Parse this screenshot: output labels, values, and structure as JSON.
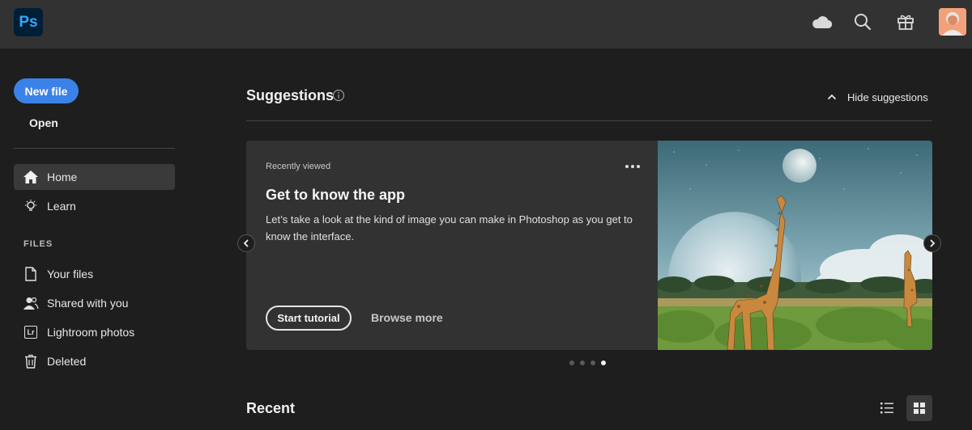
{
  "app": {
    "logo_text": "Ps"
  },
  "header": {
    "icons": [
      "cloud-icon",
      "search-icon",
      "gift-icon"
    ],
    "avatar": "avatar"
  },
  "sidebar": {
    "new_file_label": "New file",
    "open_label": "Open",
    "nav": [
      {
        "label": "Home",
        "icon": "home-icon",
        "active": true
      },
      {
        "label": "Learn",
        "icon": "lightbulb-icon",
        "active": false
      }
    ],
    "files_section_label": "FILES",
    "files": [
      {
        "label": "Your files",
        "icon": "file-icon"
      },
      {
        "label": "Shared with you",
        "icon": "shared-users-icon"
      },
      {
        "label": "Lightroom photos",
        "icon": "lightroom-icon",
        "icon_text": "Lr"
      },
      {
        "label": "Deleted",
        "icon": "trash-icon"
      }
    ]
  },
  "suggestions": {
    "title": "Suggestions",
    "hide_label": "Hide suggestions",
    "card": {
      "eyebrow": "Recently viewed",
      "title": "Get to know the app",
      "description": "Let’s take a look at the kind of image you can make in Photoshop as you get to know the interface.",
      "start_label": "Start tutorial",
      "browse_label": "Browse more"
    },
    "carousel": {
      "page_count": 4,
      "active_page": 4
    }
  },
  "recent": {
    "title": "Recent",
    "view_mode": "grid"
  },
  "colors": {
    "accent": "#3b82e8",
    "background": "#1e1e1e",
    "topbar": "#323232",
    "card": "#323232"
  }
}
